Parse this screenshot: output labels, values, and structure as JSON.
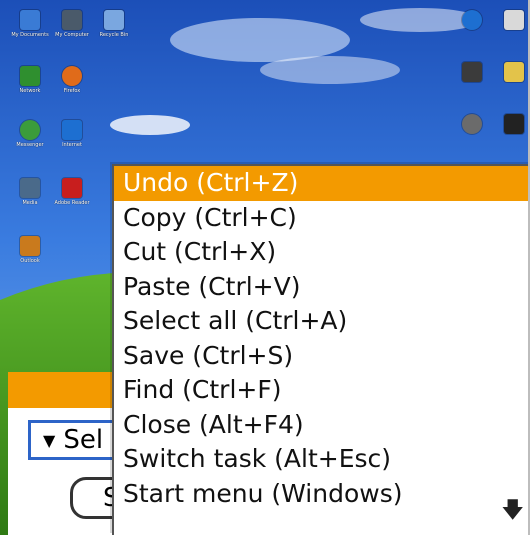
{
  "desktop": {
    "icons": [
      {
        "label": "My Documents",
        "color": "#3a7bd5"
      },
      {
        "label": "My Computer",
        "color": "#4a5a6a"
      },
      {
        "label": "Recycle Bin",
        "color": "#7aa7e0"
      },
      {
        "label": "Network",
        "color": "#2f8f2f"
      },
      {
        "label": "Firefox",
        "color": "#e06b1a"
      },
      {
        "label": "Messenger",
        "color": "#3b9c3b"
      },
      {
        "label": "Internet",
        "color": "#1d6fd1"
      },
      {
        "label": "Media",
        "color": "#4a6a8a"
      },
      {
        "label": "Adobe Reader",
        "color": "#c81e1e"
      },
      {
        "label": "Outlook",
        "color": "#c97a1d"
      }
    ]
  },
  "menu": {
    "items": [
      {
        "label": "Undo (Ctrl+Z)",
        "selected": true
      },
      {
        "label": "Copy (Ctrl+C)",
        "selected": false
      },
      {
        "label": "Cut (Ctrl+X)",
        "selected": false
      },
      {
        "label": "Paste (Ctrl+V)",
        "selected": false
      },
      {
        "label": "Select all (Ctrl+A)",
        "selected": false
      },
      {
        "label": "Save (Ctrl+S)",
        "selected": false
      },
      {
        "label": "Find (Ctrl+F)",
        "selected": false
      },
      {
        "label": "Close (Alt+F4)",
        "selected": false
      },
      {
        "label": "Switch task (Alt+Esc)",
        "selected": false
      },
      {
        "label": "Start menu (Windows)",
        "selected": false
      }
    ],
    "scroll_icon": "arrow-down-icon"
  },
  "background_form": {
    "select_text": "Sel",
    "button_text": "S"
  },
  "colors": {
    "accent": "#f39a00",
    "select_border": "#2d64c8"
  }
}
